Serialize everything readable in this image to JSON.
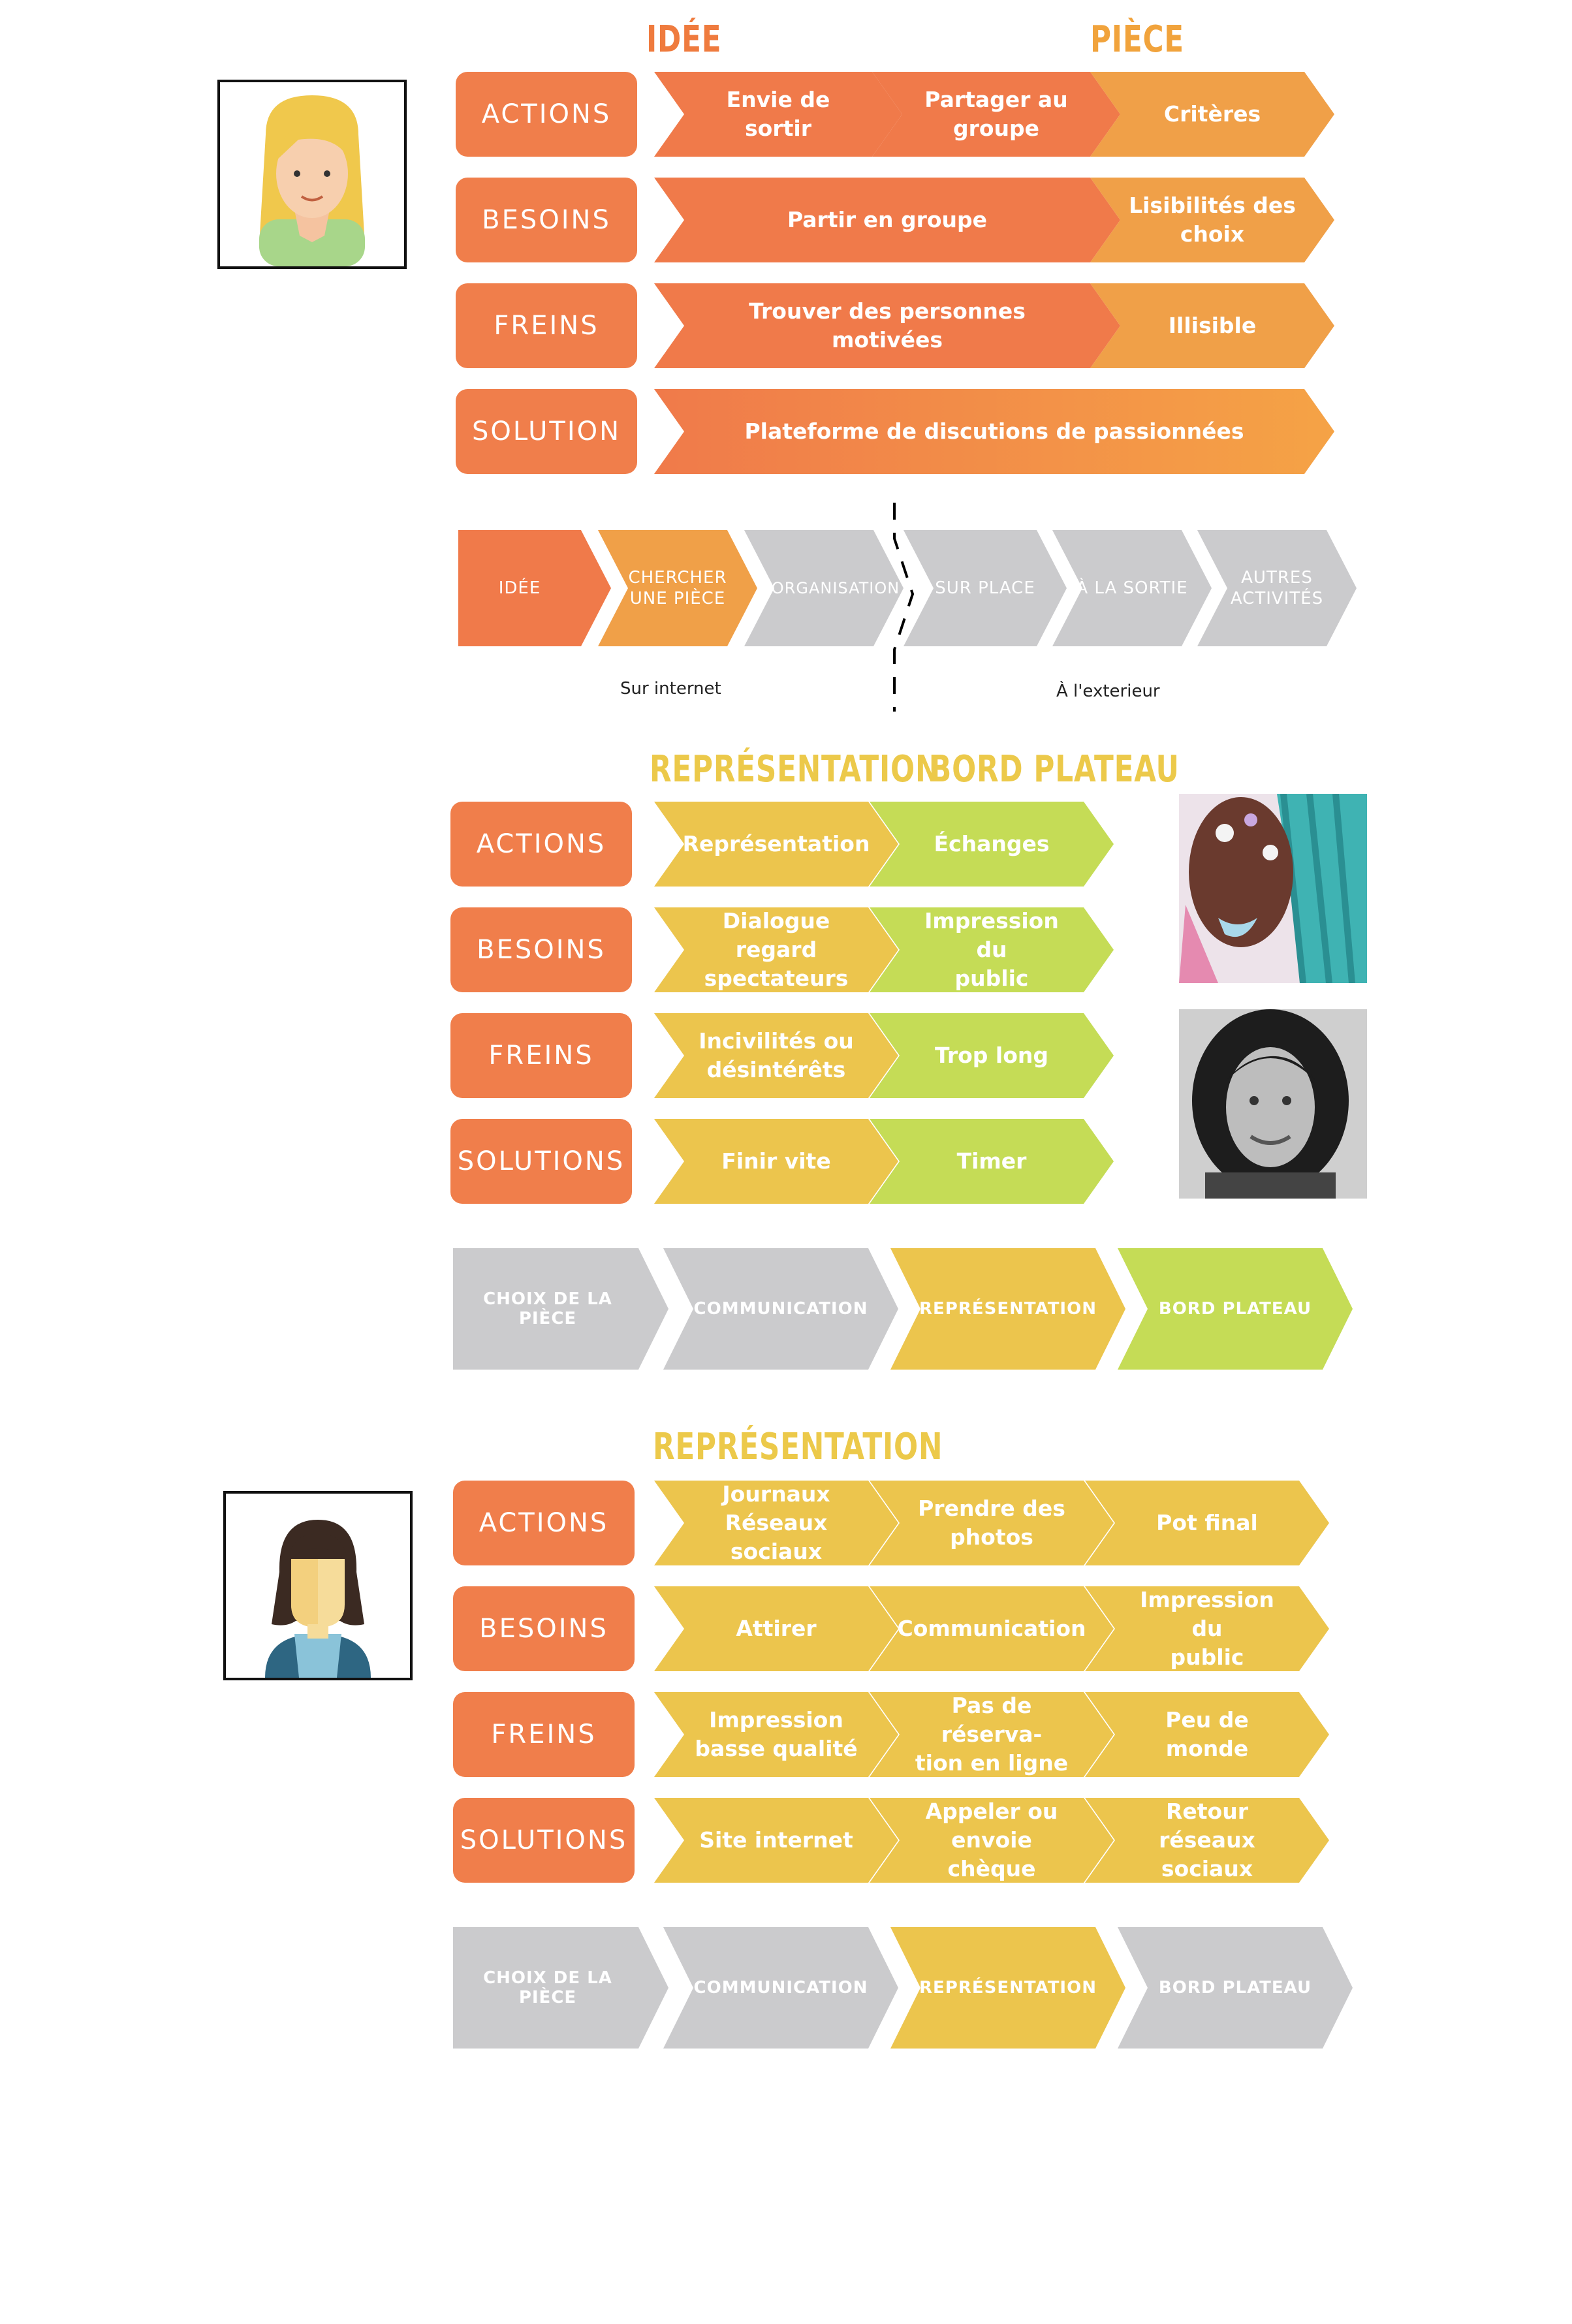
{
  "colors": {
    "label_bg": "#f07e4b",
    "orange": "#f07a4a",
    "orange_light": "#f0a048",
    "gradient_end": "#f5a346",
    "yellow": "#ecc54d",
    "green": "#c5dc56",
    "grey": "#cbcbcd",
    "header_orange": "#ef7b3e",
    "header_light_orange": "#f1a33c",
    "header_yellow": "#ecc94a"
  },
  "section1": {
    "headers": [
      "IDÉE",
      "PIÈCE"
    ],
    "labels": [
      "ACTIONS",
      "BESOINS",
      "FREINS",
      "SOLUTION"
    ],
    "rows": [
      [
        "Envie de sortir",
        "Partager au\ngroupe",
        "Critères"
      ],
      [
        "Partir en groupe",
        "Lisibilités des\nchoix"
      ],
      [
        "Trouver des personnes motivées",
        "Illisible"
      ],
      [
        "Plateforme de discutions de passionnées"
      ]
    ],
    "flow": [
      "IDÉE",
      "CHERCHER\nUNE PIÈCE",
      "ORGANISATION",
      "SUR PLACE",
      "À LA SORTIE",
      "AUTRES\nACTIVITÉS"
    ],
    "captions": [
      "Sur internet",
      "À l'exterieur"
    ],
    "portrait_icon": "blonde-woman-avatar-icon"
  },
  "section2": {
    "headers": [
      "REPRÉSENTATION",
      "BORD PLATEAU"
    ],
    "labels": [
      "ACTIONS",
      "BESOINS",
      "FREINS",
      "SOLUTIONS"
    ],
    "rows": [
      [
        "Représentation",
        "Échanges"
      ],
      [
        "Dialogue regard\nspectateurs",
        "Impression du\npublic"
      ],
      [
        "Incivilités ou\ndésintérêts",
        "Trop long"
      ],
      [
        "Finir vite",
        "Timer"
      ]
    ],
    "flow": [
      "CHOIX DE LA PIÈCE",
      "COMMUNICATION",
      "REPRÉSENTATION",
      "BORD PLATEAU"
    ],
    "photos": [
      "artist-portrait-photo",
      "woman-portrait-photo"
    ]
  },
  "section3": {
    "headers": [
      "REPRÉSENTATION"
    ],
    "labels": [
      "ACTIONS",
      "BESOINS",
      "FREINS",
      "SOLUTIONS"
    ],
    "rows": [
      [
        "Journaux\nRéseaux sociaux",
        "Prendre des\nphotos",
        "Pot final"
      ],
      [
        "Attirer",
        "Communication",
        "Impression du\npublic"
      ],
      [
        "Impression\nbasse qualité",
        "Pas de réserva-\ntion en ligne",
        "Peu de monde"
      ],
      [
        "Site internet",
        "Appeler ou\nenvoie chèque",
        "Retour réseaux\nsociaux"
      ]
    ],
    "flow": [
      "CHOIX DE LA PIÈCE",
      "COMMUNICATION",
      "REPRÉSENTATION",
      "BORD PLATEAU"
    ],
    "portrait_icon": "brunette-woman-avatar-icon"
  }
}
